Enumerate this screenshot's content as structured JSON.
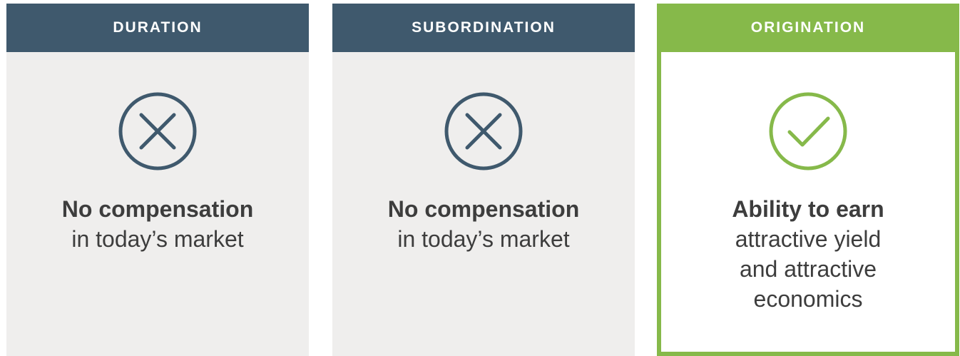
{
  "columns": [
    {
      "header": "DURATION",
      "icon": "x-circle-icon",
      "lead": "No compensation",
      "rest": "in today’s market"
    },
    {
      "header": "SUBORDINATION",
      "icon": "x-circle-icon",
      "lead": "No compensation",
      "rest": "in today’s market"
    },
    {
      "header": "ORIGINATION",
      "icon": "check-circle-icon",
      "lead": "Ability to earn",
      "rest": "attractive yield\nand attractive\neconomics"
    }
  ],
  "colors": {
    "header_dark": "#3f596d",
    "accent_green": "#86b94a",
    "card_bg": "#efeeed",
    "text": "#3d3d3d"
  }
}
